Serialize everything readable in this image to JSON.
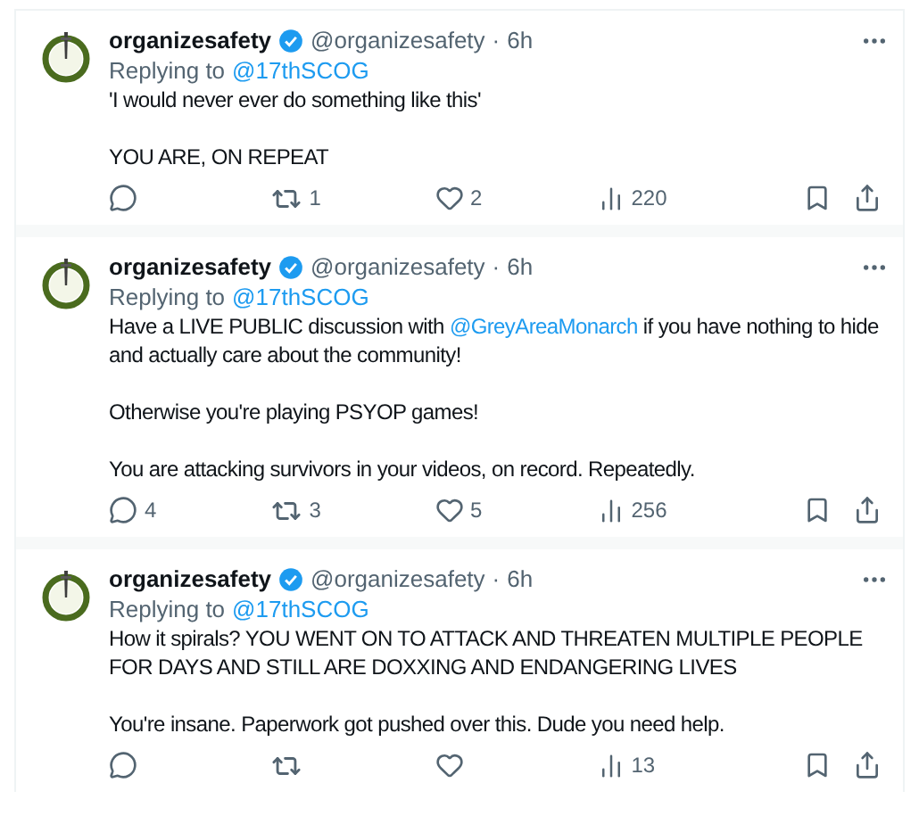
{
  "tweets": [
    {
      "display_name": "organizesafety",
      "verified": true,
      "handle": "@organizesafety",
      "separator": "·",
      "time": "6h",
      "replying_label": "Replying to",
      "reply_to": "@17thSCOG",
      "paragraphs": [
        [
          {
            "kind": "text",
            "text": "'I would never ever do something like this'"
          }
        ],
        [
          {
            "kind": "text",
            "text": "YOU ARE, ON REPEAT"
          }
        ]
      ],
      "stats": {
        "retweets": "1",
        "likes": "2",
        "views": "220"
      }
    },
    {
      "display_name": "organizesafety",
      "verified": true,
      "handle": "@organizesafety",
      "separator": "·",
      "time": "6h",
      "replying_label": "Replying to",
      "reply_to": "@17thSCOG",
      "paragraphs": [
        [
          {
            "kind": "text",
            "text": "Have a LIVE PUBLIC discussion with "
          },
          {
            "kind": "mention",
            "text": "@GreyAreaMonarch"
          },
          {
            "kind": "text",
            "text": " if you have nothing to hide and actually care about the community!"
          }
        ],
        [
          {
            "kind": "text",
            "text": "Otherwise you're playing PSYOP games!"
          }
        ],
        [
          {
            "kind": "text",
            "text": "You are attacking survivors in your videos, on record. Repeatedly."
          }
        ]
      ],
      "stats": {
        "replies": "4",
        "retweets": "3",
        "likes": "5",
        "views": "256"
      }
    },
    {
      "display_name": "organizesafety",
      "verified": true,
      "handle": "@organizesafety",
      "separator": "·",
      "time": "6h",
      "replying_label": "Replying to",
      "reply_to": "@17thSCOG",
      "paragraphs": [
        [
          {
            "kind": "text",
            "text": "How it spirals? YOU WENT ON TO ATTACK AND THREATEN MULTIPLE PEOPLE FOR DAYS AND STILL ARE DOXXING AND ENDANGERING LIVES"
          }
        ],
        [
          {
            "kind": "text",
            "text": "You're insane. Paperwork got pushed over this. Dude you need help."
          }
        ]
      ],
      "stats": {
        "views": "13"
      }
    }
  ]
}
